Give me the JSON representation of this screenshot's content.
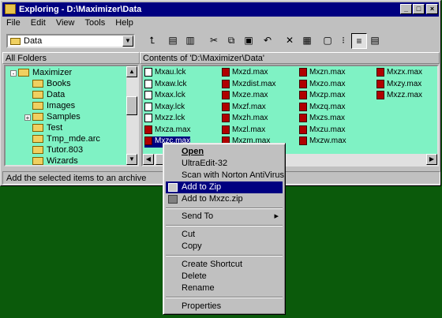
{
  "window": {
    "title": "Exploring - D:\\Maximizer\\Data"
  },
  "menubar": [
    "File",
    "Edit",
    "View",
    "Tools",
    "Help"
  ],
  "toolbar": {
    "combo_value": "Data",
    "buttons": [
      "up-folder-icon",
      "map-drive-icon",
      "disconnect-drive-icon",
      "cut-icon",
      "copy-icon",
      "paste-icon",
      "undo-icon",
      "delete-icon",
      "properties-icon",
      "large-icons-icon",
      "small-icons-icon",
      "list-icon",
      "details-icon"
    ]
  },
  "panes": {
    "left_header": "All Folders",
    "right_header": "Contents of 'D:\\Maximizer\\Data'"
  },
  "tree": [
    {
      "label": "Maximizer",
      "expand": "-"
    },
    {
      "label": "Books"
    },
    {
      "label": "Data"
    },
    {
      "label": "Images"
    },
    {
      "label": "Samples",
      "expand": "+"
    },
    {
      "label": "Test"
    },
    {
      "label": "Tmp_mde.arc"
    },
    {
      "label": "Tutor.803"
    },
    {
      "label": "Wizards"
    }
  ],
  "files": [
    [
      "Mxau.lck",
      "Mxzd.max",
      "Mxzn.max",
      "Mxzx.max"
    ],
    [
      "Mxaw.lck",
      "Mxzdist.max",
      "Mxzo.max",
      "Mxzy.max"
    ],
    [
      "Mxax.lck",
      "Mxze.max",
      "Mxzp.max",
      "Mxzz.max"
    ],
    [
      "Mxay.lck",
      "Mxzf.max",
      "Mxzq.max",
      ""
    ],
    [
      "Mxzz.lck",
      "Mxzh.max",
      "Mxzs.max",
      ""
    ],
    [
      "Mxza.max",
      "Mxzl.max",
      "Mxzu.max",
      ""
    ],
    [
      "Mxzc.max",
      "Mxzm.max",
      "Mxzw.max",
      ""
    ]
  ],
  "status": "Add the selected items to an archive",
  "context_menu": [
    {
      "label": "Open",
      "bold": true
    },
    {
      "label": "UltraEdit-32"
    },
    {
      "label": "Scan with Norton AntiVirus"
    },
    {
      "label": "Add to Zip",
      "selected": true
    },
    {
      "label": "Add to Mxzc.zip"
    },
    {
      "label": "Send To",
      "submenu": true
    },
    {
      "label": "Cut"
    },
    {
      "label": "Copy"
    },
    {
      "label": "Create Shortcut"
    },
    {
      "label": "Delete"
    },
    {
      "label": "Rename"
    },
    {
      "label": "Properties"
    }
  ],
  "colors": {
    "titlebar": "#000080",
    "desktop": "#0b5a0b",
    "pane_bg": "#7ff2c4",
    "selection": "#000080"
  }
}
